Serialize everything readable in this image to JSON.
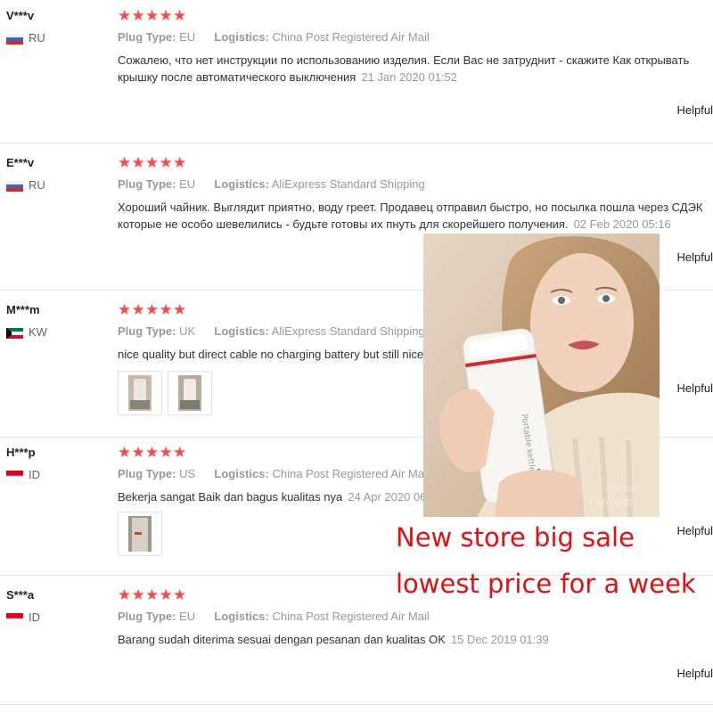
{
  "reviews": [
    {
      "user": "V***v",
      "country": "RU",
      "flag": "russia",
      "stars": 5,
      "plug_label": "Plug Type:",
      "plug_value": "EU",
      "logistics_label": "Logistics:",
      "logistics_value": "China Post Registered Air Mail",
      "text": "Сожалею, что нет инструкции по использованию изделия. Если Вас не затруднит - скажите Как открывать крышку после автоматического выключения",
      "date": "21 Jan 2020 01:52",
      "helpful": "Helpful"
    },
    {
      "user": "E***v",
      "country": "RU",
      "flag": "russia",
      "stars": 5,
      "plug_label": "Plug Type:",
      "plug_value": "EU",
      "logistics_label": "Logistics:",
      "logistics_value": "AliExpress Standard Shipping",
      "text": "Хороший чайник. Выглядит приятно, воду греет. Продавец отправил быстро, но посылка пошла через СДЭК которые не особо шевелились - будьте готовы их пнуть для скорейшего получения.",
      "date": "02 Feb 2020 05:16",
      "helpful": "Helpful"
    },
    {
      "user": "M***m",
      "country": "KW",
      "flag": "kuwait",
      "stars": 5,
      "plug_label": "Plug Type:",
      "plug_value": "UK",
      "logistics_label": "Logistics:",
      "logistics_value": "AliExpress Standard Shipping",
      "text": "nice quality but direct cable no charging battery but still nice device",
      "date": "",
      "helpful": "Helpful"
    },
    {
      "user": "H***p",
      "country": "ID",
      "flag": "indonesia",
      "stars": 5,
      "plug_label": "Plug Type:",
      "plug_value": "US",
      "logistics_label": "Logistics:",
      "logistics_value": "China Post Registered Air Mail",
      "text": "Bekerja sangat Baik dan bagus kualitas nya",
      "date": "24 Apr 2020 06:",
      "helpful": "Helpful"
    },
    {
      "user": "S***a",
      "country": "ID",
      "flag": "indonesia",
      "stars": 5,
      "plug_label": "Plug Type:",
      "plug_value": "EU",
      "logistics_label": "Logistics:",
      "logistics_value": "China Post Registered Air Mail",
      "text": "Barang sudah diterima sesuai dengan pesanan dan kualitas OK",
      "date": "15 Dec 2019 01:39",
      "helpful": "Helpful"
    }
  ],
  "promo": {
    "line1": "New store big sale",
    "line2": "lowest price for a week",
    "color": "#e01010"
  },
  "colors": {
    "stars": "#ff4747"
  }
}
